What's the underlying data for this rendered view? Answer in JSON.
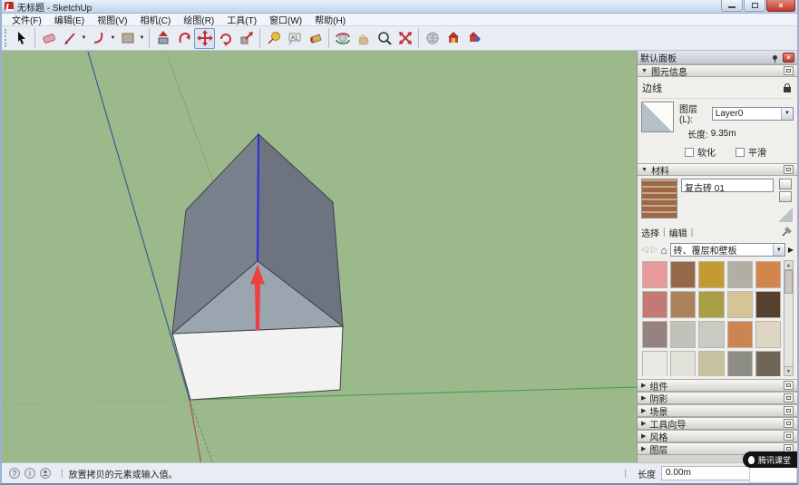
{
  "window": {
    "title": "无标题 - SketchUp"
  },
  "menu": {
    "items": [
      "文件(F)",
      "编辑(E)",
      "视图(V)",
      "相机(C)",
      "绘图(R)",
      "工具(T)",
      "窗口(W)",
      "帮助(H)"
    ]
  },
  "toolbar": {
    "icons": [
      "select",
      "eraser",
      "line",
      "arc",
      "rectangle",
      "push-pull",
      "follow-me",
      "move",
      "rotate",
      "scale",
      "tape-measure",
      "text-label",
      "paint-bucket",
      "orbit",
      "pan",
      "zoom",
      "zoom-extents",
      "add-location",
      "get-models",
      "share-model"
    ],
    "active_tool": "move"
  },
  "scene": {
    "colors": {
      "bg": "#9bb98b",
      "roof_left": "#79818c",
      "roof_right": "#6d747f",
      "gable": "#9aa5af",
      "box_front": "#f2f2f0",
      "edge": "#3e434b",
      "ridge_blue": "#2b2be0",
      "arrow_red": "#ef4040",
      "axis_blue": "#3d5a96",
      "axis_green": "#3f9c3f",
      "axis_red": "#b0563c",
      "axis_blue_dashed": "#5c7a7a",
      "axis_green_faint": "#85a885",
      "axis_olive_faint": "#87a06f"
    }
  },
  "panel": {
    "title": "默认面板",
    "entity_info": {
      "title": "图元信息",
      "entity_type": "边线",
      "layer_label": "图层(L):",
      "layer_value": "Layer0",
      "length_label": "长度:",
      "length_value": "9.35m",
      "soften_label": "软化",
      "smooth_label": "平滑"
    },
    "materials": {
      "title": "材料",
      "name": "复古砖 01",
      "tab_select": "选择",
      "tab_edit": "编辑",
      "category": "砖、覆层和壁板",
      "swatches": [
        "#e89a9a",
        "#96684a",
        "#c49a32",
        "#b2aea4",
        "#d4854e",
        "#c47a74",
        "#ac825c",
        "#aa9e44",
        "#d6c496",
        "#55412e",
        "#96827e",
        "#c2c2ba",
        "#cac9c2",
        "#cc8450",
        "#ded6c0",
        "#eae9e4",
        "#e2e1da",
        "#c6c2a0",
        "#8e8d85",
        "#6e6656"
      ]
    },
    "collapsed_sections": [
      "组件",
      "阴影",
      "场景",
      "工具向导",
      "风格",
      "图层"
    ]
  },
  "statusbar": {
    "hint": "放置拷贝的元素或输入值。",
    "measure_label": "长度",
    "measure_value": "0.00m"
  },
  "popup": {
    "label": "腾讯课堂"
  }
}
